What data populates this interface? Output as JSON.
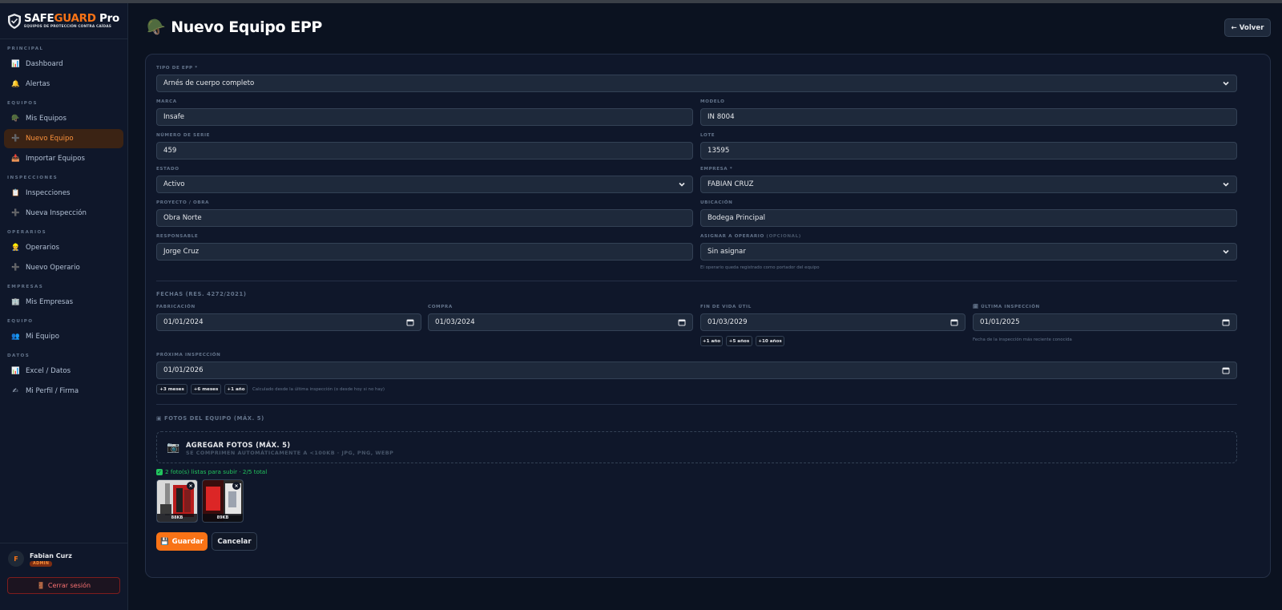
{
  "brand": {
    "name_main": "SAFE",
    "name_accent": "GUARD",
    "name_suffix": " Pro",
    "tagline": "EQUIPOS DE PROTECCIÓN CONTRA CAÍDAS"
  },
  "sidebar": {
    "sections": [
      {
        "title": "PRINCIPAL",
        "items": [
          {
            "label": "Dashboard",
            "icon": "📊"
          },
          {
            "label": "Alertas",
            "icon": "🔔"
          }
        ]
      },
      {
        "title": "EQUIPOS",
        "items": [
          {
            "label": "Mis Equipos",
            "icon": "🪖"
          },
          {
            "label": "Nuevo Equipo",
            "icon": "➕",
            "active": true
          },
          {
            "label": "Importar Equipos",
            "icon": "📥"
          }
        ]
      },
      {
        "title": "INSPECCIONES",
        "items": [
          {
            "label": "Inspecciones",
            "icon": "📋"
          },
          {
            "label": "Nueva Inspección",
            "icon": "➕"
          }
        ]
      },
      {
        "title": "OPERARIOS",
        "items": [
          {
            "label": "Operarios",
            "icon": "👷"
          },
          {
            "label": "Nuevo Operario",
            "icon": "➕"
          }
        ]
      },
      {
        "title": "EMPRESAS",
        "items": [
          {
            "label": "Mis Empresas",
            "icon": "🏢"
          }
        ]
      },
      {
        "title": "EQUIPO",
        "items": [
          {
            "label": "Mi Equipo",
            "icon": "👥"
          }
        ]
      },
      {
        "title": "DATOS",
        "items": [
          {
            "label": "Excel / Datos",
            "icon": "📊"
          },
          {
            "label": "Mi Perfil / Firma",
            "icon": "✍"
          }
        ]
      }
    ]
  },
  "user": {
    "initial": "F",
    "name": "Fabian Curz",
    "role": "ADMIN",
    "logout_label": "Cerrar sesión",
    "logout_icon": "🚪"
  },
  "header": {
    "icon": "🪖",
    "title": "Nuevo Equipo EPP",
    "back_label": "← Volver"
  },
  "form": {
    "tipo": {
      "label": "TIPO DE EPP *",
      "value": "Arnés de cuerpo completo"
    },
    "marca": {
      "label": "MARCA",
      "value": "Insafe"
    },
    "modelo": {
      "label": "MODELO",
      "value": "IN 8004"
    },
    "serie": {
      "label": "NÚMERO DE SERIE",
      "value": "459"
    },
    "lote": {
      "label": "LOTE",
      "value": "13595"
    },
    "estado": {
      "label": "ESTADO",
      "value": "Activo"
    },
    "empresa": {
      "label": "EMPRESA *",
      "value": "FABIAN CRUZ"
    },
    "proyecto": {
      "label": "PROYECTO / OBRA",
      "value": "Obra Norte"
    },
    "ubicacion": {
      "label": "UBICACIÓN",
      "value": "Bodega Principal"
    },
    "responsable": {
      "label": "RESPONSABLE",
      "value": "Jorge Cruz"
    },
    "operario": {
      "label": "ASIGNAR A OPERARIO",
      "label_opt": "(OPCIONAL)",
      "value": "Sin asignar",
      "hint": "El operario queda registrado como portador del equipo"
    }
  },
  "fechas": {
    "title": "FECHAS (RES. 4272/2021)",
    "fabricacion": {
      "label": "FABRICACIÓN",
      "value": "01/01/2024"
    },
    "compra": {
      "label": "COMPRA",
      "value": "01/03/2024"
    },
    "fin_vida": {
      "label": "FIN DE VIDA ÚTIL",
      "value": "01/03/2029",
      "chips": [
        "+1 año",
        "+5 años",
        "+10 años"
      ]
    },
    "ultima": {
      "icon": "🗓",
      "label": "ÚLTIMA INSPECCIÓN",
      "value": "01/01/2025",
      "hint": "Fecha de la inspección más reciente conocida"
    },
    "proxima": {
      "label": "PRÓXIMA INSPECCIÓN",
      "value": "01/01/2026",
      "chips": [
        "+3 meses",
        "+6 meses",
        "+1 año"
      ],
      "hint": "Calculado desde la última inspección (o desde hoy si no hay)"
    }
  },
  "fotos": {
    "icon": "📷",
    "title": "FOTOS DEL EQUIPO (MÁX. 5)",
    "upload_title": "AGREGAR FOTOS (MÁX. 5)",
    "upload_sub": "SE COMPRIMEN AUTOMÁTICAMENTE A <100KB · JPG, PNG, WEBP",
    "ready_check": "✓",
    "ready": "2 foto(s) listas para subir · 2/5 total",
    "thumbs": [
      {
        "size": "88KB",
        "close": "×"
      },
      {
        "size": "89KB",
        "close": "×"
      }
    ]
  },
  "actions": {
    "save_icon": "💾",
    "save_label": "Guardar",
    "cancel_label": "Cancelar"
  }
}
